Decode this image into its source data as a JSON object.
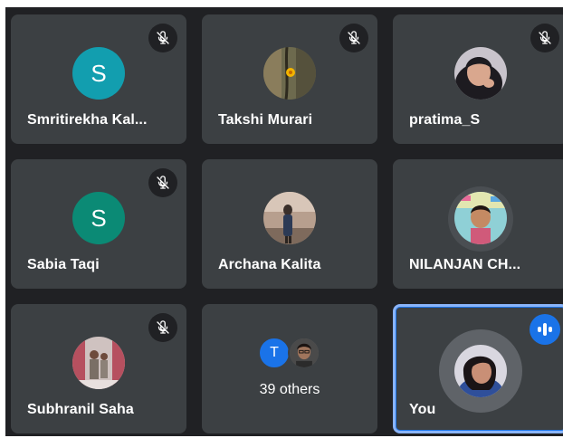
{
  "participants": [
    {
      "name": "Smritirekha Kal...",
      "initial": "S",
      "avatar_color": "#129eaf",
      "muted": true
    },
    {
      "name": "Takshi Murari",
      "muted": true
    },
    {
      "name": "pratima_S",
      "muted": true
    },
    {
      "name": "Sabia Taqi",
      "initial": "S",
      "avatar_color": "#0b8a75",
      "muted": true
    },
    {
      "name": "Archana Kalita",
      "muted": false
    },
    {
      "name": "NILANJAN CH...",
      "muted": false
    },
    {
      "name": "Subhranil Saha",
      "muted": true
    },
    {
      "others_label": "39 others",
      "mini_initial": "T"
    },
    {
      "name": "You",
      "speaking": true
    }
  ],
  "icons": {
    "muted": "mic-off-icon",
    "speaking": "audio-level-icon"
  },
  "colors": {
    "tile": "#3c4043",
    "background": "#202124",
    "self_border": "#8ab4f8",
    "speaking_badge": "#1a73e8"
  }
}
